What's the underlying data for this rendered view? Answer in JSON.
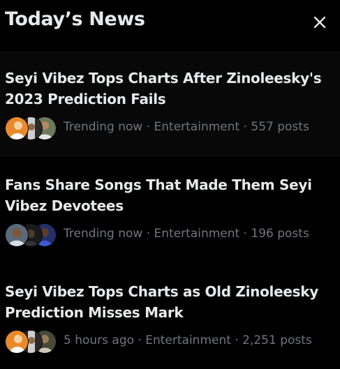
{
  "header": {
    "title": "Today’s News",
    "close_icon": "close-icon"
  },
  "items": [
    {
      "title": "Seyi Vibez Tops Charts After Zinoleesky's 2023 Prediction Fails",
      "meta": "Trending now · Entertainment · 557 posts"
    },
    {
      "title": "Fans Share Songs That Made Them Seyi Vibez Devotees",
      "meta": "Trending now · Entertainment · 196 posts"
    },
    {
      "title": "Seyi Vibez Tops Charts as Old Zinoleesky Prediction Misses Mark",
      "meta": "5 hours ago · Entertainment · 2,251 posts"
    }
  ],
  "colors": {
    "background": "#000000",
    "hover_background": "#080808",
    "text_primary": "#e7e9ea",
    "text_secondary": "#71767b"
  }
}
